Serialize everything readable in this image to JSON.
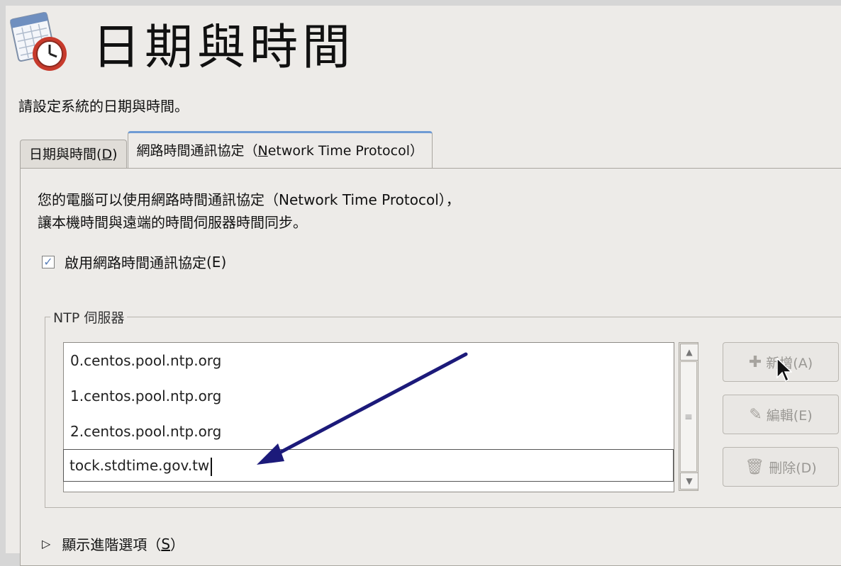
{
  "header": {
    "title": "日期與時間",
    "icon": "calendar-clock-icon"
  },
  "subtitle": "請設定系統的日期與時間。",
  "tabs": [
    {
      "label": "日期與時間",
      "mnemonic": "D",
      "active": false
    },
    {
      "label": "網路時間通訊協定（",
      "mnemonic": "N",
      "label_rest": "etwork Time Protocol）",
      "active": true
    }
  ],
  "ntp": {
    "description_line1": "您的電腦可以使用網路時間通訊協定（Network Time Protocol），",
    "description_line2": "讓本機時間與遠端的時間伺服器時間同步。",
    "enable_checkbox": {
      "label": "啟用網路時間通訊協定",
      "mnemonic": "(E)",
      "checked": true
    },
    "servers_frame_label": "NTP 伺服器",
    "servers": [
      "0.centos.pool.ntp.org",
      "1.centos.pool.ntp.org",
      "2.centos.pool.ntp.org",
      "tock.stdtime.gov.tw"
    ],
    "buttons": {
      "add": "新增(A)",
      "edit": "編輯(E)",
      "delete": "刪除(D)"
    },
    "advanced_toggle": {
      "label": "顯示進階選項（",
      "mnemonic": "S",
      "label_end": "）"
    }
  },
  "colors": {
    "annotation_arrow": "#1c1a7a",
    "active_tab_accent": "#6f9bd4"
  }
}
